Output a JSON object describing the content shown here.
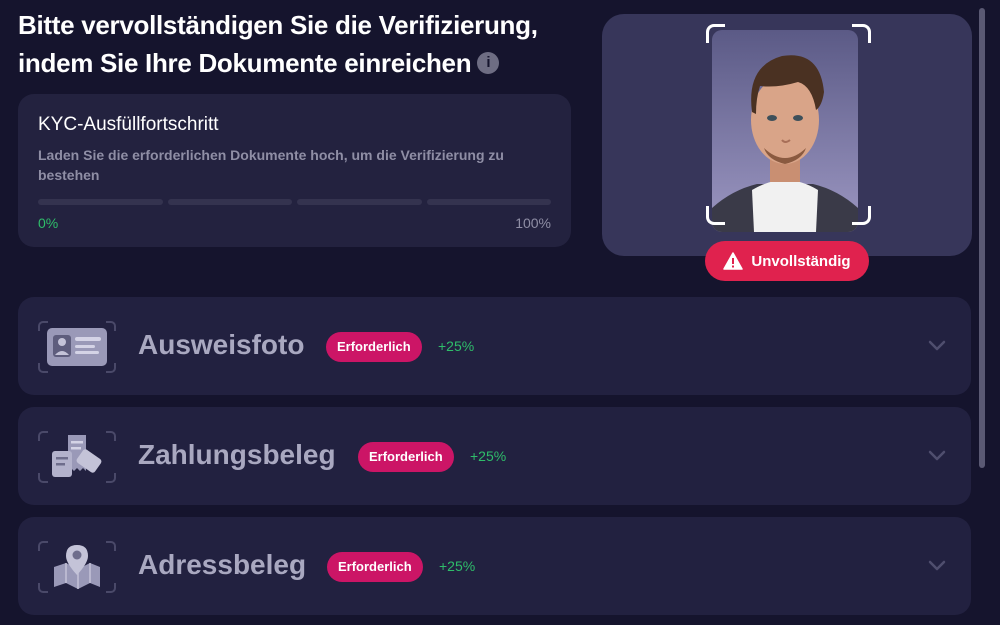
{
  "header": {
    "title": "Bitte vervollständigen Sie die Verifizierung, indem Sie Ihre Dokumente einreichen",
    "info_icon": "info-icon"
  },
  "progress": {
    "title": "KYC-Ausfüllfortschritt",
    "description": "Laden Sie die erforderlichen Dokumente hoch, um die Verifizierung zu bestehen",
    "start_label": "0%",
    "end_label": "100%",
    "segments": 4,
    "completed_fraction": 0
  },
  "profile": {
    "status_label": "Unvollständig",
    "status_icon": "warning-icon",
    "status_color": "#e0224e"
  },
  "documents": [
    {
      "title": "Ausweisfoto",
      "badge": "Erforderlich",
      "bonus": "+25%",
      "icon": "id-card-icon"
    },
    {
      "title": "Zahlungsbeleg",
      "badge": "Erforderlich",
      "bonus": "+25%",
      "icon": "receipt-icon"
    },
    {
      "title": "Adressbeleg",
      "badge": "Erforderlich",
      "bonus": "+25%",
      "icon": "map-pin-icon"
    }
  ],
  "colors": {
    "background": "#15142d",
    "card": "#222140",
    "accent_green": "#2fbd6a",
    "badge_pink": "#cc1566"
  }
}
